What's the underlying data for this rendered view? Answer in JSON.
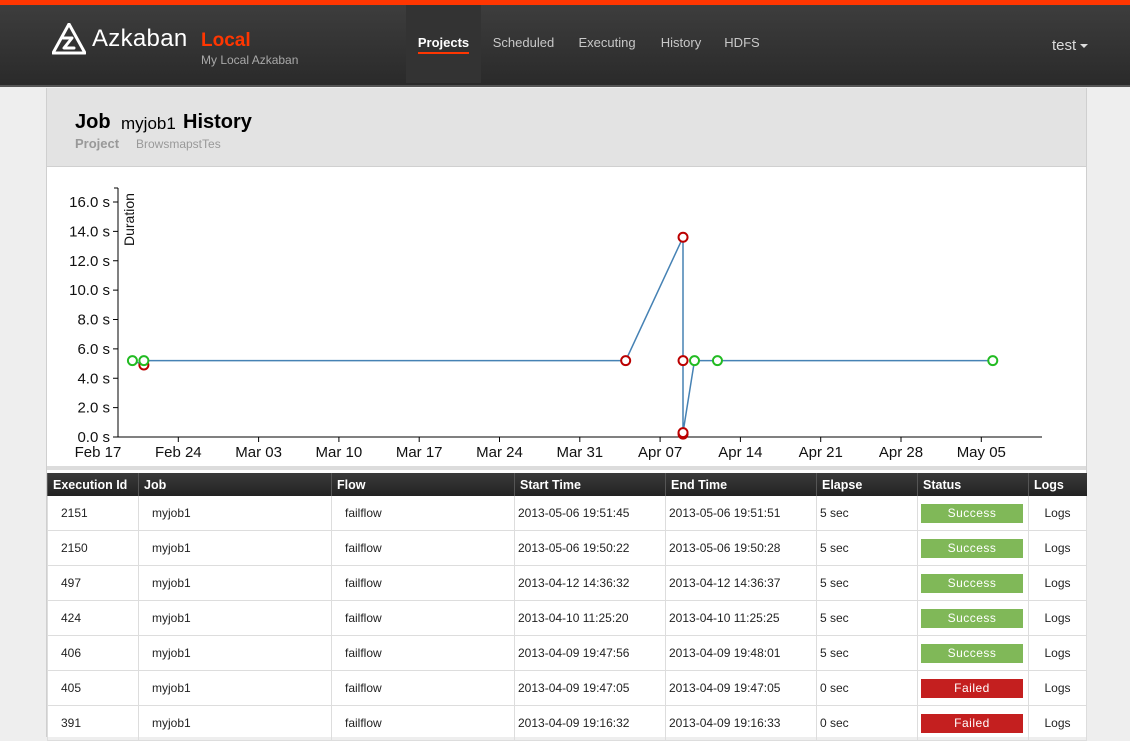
{
  "app": {
    "name": "Azkaban",
    "env": "Local",
    "subtitle": "My Local Azkaban",
    "accent_color": "#ff3601"
  },
  "nav": {
    "items": [
      {
        "label": "Projects",
        "active": true
      },
      {
        "label": "Scheduled",
        "active": false
      },
      {
        "label": "Executing",
        "active": false
      },
      {
        "label": "History",
        "active": false
      },
      {
        "label": "HDFS",
        "active": false
      }
    ],
    "user": "test"
  },
  "header": {
    "job_label": "Job",
    "job_name": "myjob1",
    "history_label": "History",
    "project_label": "Project",
    "project_name": "BrowsmapstTes"
  },
  "chart_data": {
    "type": "scatter",
    "title": "",
    "xlabel": "",
    "ylabel": "Duration",
    "ylim": [
      0,
      16
    ],
    "y_ticks": [
      "0.0 s",
      "2.0 s",
      "4.0 s",
      "6.0 s",
      "8.0 s",
      "10.0 s",
      "12.0 s",
      "14.0 s",
      "16.0 s"
    ],
    "x_ticks": [
      "Feb 17",
      "Feb 24",
      "Mar 03",
      "Mar 10",
      "Mar 17",
      "Mar 24",
      "Mar 31",
      "Apr 07",
      "Apr 14",
      "Apr 21",
      "Apr 28",
      "May 05"
    ],
    "xlim": [
      "2013-02-17",
      "2013-05-09"
    ],
    "colors": {
      "line": "#4682b4",
      "success": "#22bb22",
      "failed": "#bb0000"
    },
    "points": [
      {
        "date": "2013-02-20",
        "value": 5.2,
        "status": "success"
      },
      {
        "date": "2013-02-21",
        "value": 4.9,
        "status": "failed"
      },
      {
        "date": "2013-02-21",
        "value": 5.2,
        "status": "success"
      },
      {
        "date": "2013-04-04",
        "value": 5.2,
        "status": "failed"
      },
      {
        "date": "2013-04-09",
        "value": 13.6,
        "status": "failed"
      },
      {
        "date": "2013-04-09",
        "value": 5.2,
        "status": "failed"
      },
      {
        "date": "2013-04-09",
        "value": 0.2,
        "status": "failed"
      },
      {
        "date": "2013-04-09",
        "value": 0.3,
        "status": "failed"
      },
      {
        "date": "2013-04-10",
        "value": 5.2,
        "status": "success"
      },
      {
        "date": "2013-04-12",
        "value": 5.2,
        "status": "success"
      },
      {
        "date": "2013-05-06",
        "value": 5.2,
        "status": "success"
      }
    ]
  },
  "table": {
    "columns": [
      "Execution Id",
      "Job",
      "Flow",
      "Start Time",
      "End Time",
      "Elapse",
      "Status",
      "Logs"
    ],
    "rows": [
      {
        "id": "2151",
        "job": "myjob1",
        "flow": "failflow",
        "start": "2013-05-06 19:51:45",
        "end": "2013-05-06 19:51:51",
        "elapse": "5 sec",
        "status": "Success",
        "logs": "Logs"
      },
      {
        "id": "2150",
        "job": "myjob1",
        "flow": "failflow",
        "start": "2013-05-06 19:50:22",
        "end": "2013-05-06 19:50:28",
        "elapse": "5 sec",
        "status": "Success",
        "logs": "Logs"
      },
      {
        "id": "497",
        "job": "myjob1",
        "flow": "failflow",
        "start": "2013-04-12 14:36:32",
        "end": "2013-04-12 14:36:37",
        "elapse": "5 sec",
        "status": "Success",
        "logs": "Logs"
      },
      {
        "id": "424",
        "job": "myjob1",
        "flow": "failflow",
        "start": "2013-04-10 11:25:20",
        "end": "2013-04-10 11:25:25",
        "elapse": "5 sec",
        "status": "Success",
        "logs": "Logs"
      },
      {
        "id": "406",
        "job": "myjob1",
        "flow": "failflow",
        "start": "2013-04-09 19:47:56",
        "end": "2013-04-09 19:48:01",
        "elapse": "5 sec",
        "status": "Success",
        "logs": "Logs"
      },
      {
        "id": "405",
        "job": "myjob1",
        "flow": "failflow",
        "start": "2013-04-09 19:47:05",
        "end": "2013-04-09 19:47:05",
        "elapse": "0 sec",
        "status": "Failed",
        "logs": "Logs"
      },
      {
        "id": "391",
        "job": "myjob1",
        "flow": "failflow",
        "start": "2013-04-09 19:16:32",
        "end": "2013-04-09 19:16:33",
        "elapse": "0 sec",
        "status": "Failed",
        "logs": "Logs"
      }
    ]
  }
}
